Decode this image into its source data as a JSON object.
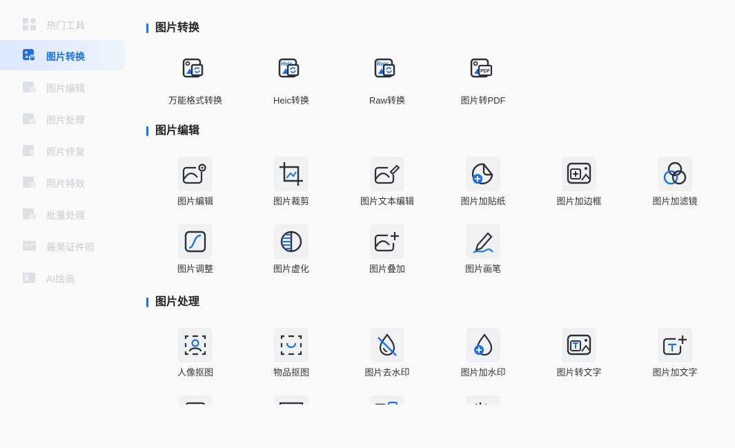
{
  "sidebar": {
    "items": [
      {
        "label": "热门工具",
        "icon": "hot-tools-icon",
        "active": false
      },
      {
        "label": "图片转换",
        "icon": "image-convert-icon",
        "active": true
      },
      {
        "label": "图片编辑",
        "icon": "image-edit-icon",
        "active": false
      },
      {
        "label": "图片处理",
        "icon": "image-process-icon",
        "active": false
      },
      {
        "label": "照片修复",
        "icon": "photo-repair-icon",
        "active": false
      },
      {
        "label": "照片特效",
        "icon": "photo-effects-icon",
        "active": false
      },
      {
        "label": "批量处理",
        "icon": "batch-process-icon",
        "active": false
      },
      {
        "label": "最美证件照",
        "icon": "id-photo-icon",
        "active": false
      },
      {
        "label": "AI绘画",
        "icon": "ai-painting-icon",
        "active": false
      }
    ]
  },
  "sections": {
    "convert": {
      "title": "图片转换",
      "tools": [
        {
          "label": "万能格式转换",
          "icon": "universal-convert-icon"
        },
        {
          "label": "Heic转换",
          "icon": "heic-convert-icon",
          "badge": "Heic"
        },
        {
          "label": "Raw转换",
          "icon": "raw-convert-icon",
          "badge": "Raw"
        },
        {
          "label": "图片转PDF",
          "icon": "image-to-pdf-icon",
          "badge": "PDF"
        }
      ]
    },
    "edit": {
      "title": "图片编辑",
      "tools": [
        {
          "label": "图片编辑",
          "icon": "image-edit-gear-icon"
        },
        {
          "label": "图片裁剪",
          "icon": "crop-icon"
        },
        {
          "label": "图片文本编辑",
          "icon": "text-edit-icon"
        },
        {
          "label": "图片加贴纸",
          "icon": "sticker-icon"
        },
        {
          "label": "图片加边框",
          "icon": "border-icon"
        },
        {
          "label": "图片加滤镜",
          "icon": "filter-icon"
        },
        {
          "label": "图片调整",
          "icon": "adjust-curve-icon"
        },
        {
          "label": "图片虚化",
          "icon": "blur-icon"
        },
        {
          "label": "图片叠加",
          "icon": "overlay-icon"
        },
        {
          "label": "图片画笔",
          "icon": "brush-icon"
        }
      ]
    },
    "process": {
      "title": "图片处理",
      "tools": [
        {
          "label": "人像抠图",
          "icon": "portrait-cutout-icon"
        },
        {
          "label": "物品抠图",
          "icon": "object-cutout-icon"
        },
        {
          "label": "图片去水印",
          "icon": "remove-watermark-icon"
        },
        {
          "label": "图片加水印",
          "icon": "add-watermark-icon"
        },
        {
          "label": "图片转文字",
          "icon": "image-to-text-icon"
        },
        {
          "label": "图片加文字",
          "icon": "add-text-icon"
        }
      ]
    }
  },
  "colors": {
    "accent": "#1e6fe8",
    "icon_stroke": "#2b2f36",
    "sidebar_inactive": "#c9ccd1",
    "active_bg": "#dbe8fd"
  }
}
